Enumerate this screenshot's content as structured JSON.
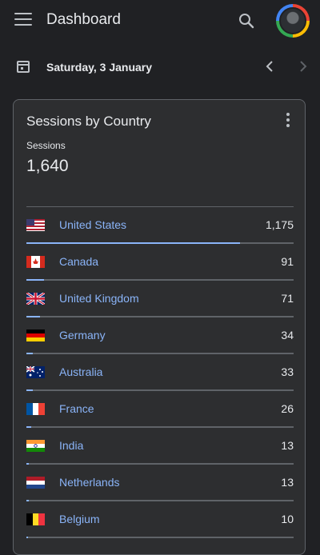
{
  "app": {
    "title": "Dashboard"
  },
  "date": {
    "label": "Saturday, 3 January"
  },
  "card": {
    "title": "Sessions by Country",
    "metric_label": "Sessions",
    "metric_value": "1,640"
  },
  "rows": [
    {
      "country": "United States",
      "value": "1,175",
      "share": 0.8,
      "flag": "us-flag"
    },
    {
      "country": "Canada",
      "value": "91",
      "share": 0.066,
      "flag": "ca-flag"
    },
    {
      "country": "United Kingdom",
      "value": "71",
      "share": 0.052,
      "flag": "gb-flag"
    },
    {
      "country": "Germany",
      "value": "34",
      "share": 0.025,
      "flag": "de-flag"
    },
    {
      "country": "Australia",
      "value": "33",
      "share": 0.024,
      "flag": "au-flag"
    },
    {
      "country": "France",
      "value": "26",
      "share": 0.019,
      "flag": "fr-flag"
    },
    {
      "country": "India",
      "value": "13",
      "share": 0.01,
      "flag": "in-flag"
    },
    {
      "country": "Netherlands",
      "value": "13",
      "share": 0.01,
      "flag": "nl-flag"
    },
    {
      "country": "Belgium",
      "value": "10",
      "share": 0.007,
      "flag": "be-flag"
    }
  ],
  "colors": {
    "accent": "#8ab4f8",
    "background": "#202124",
    "card": "#2d2e30"
  }
}
